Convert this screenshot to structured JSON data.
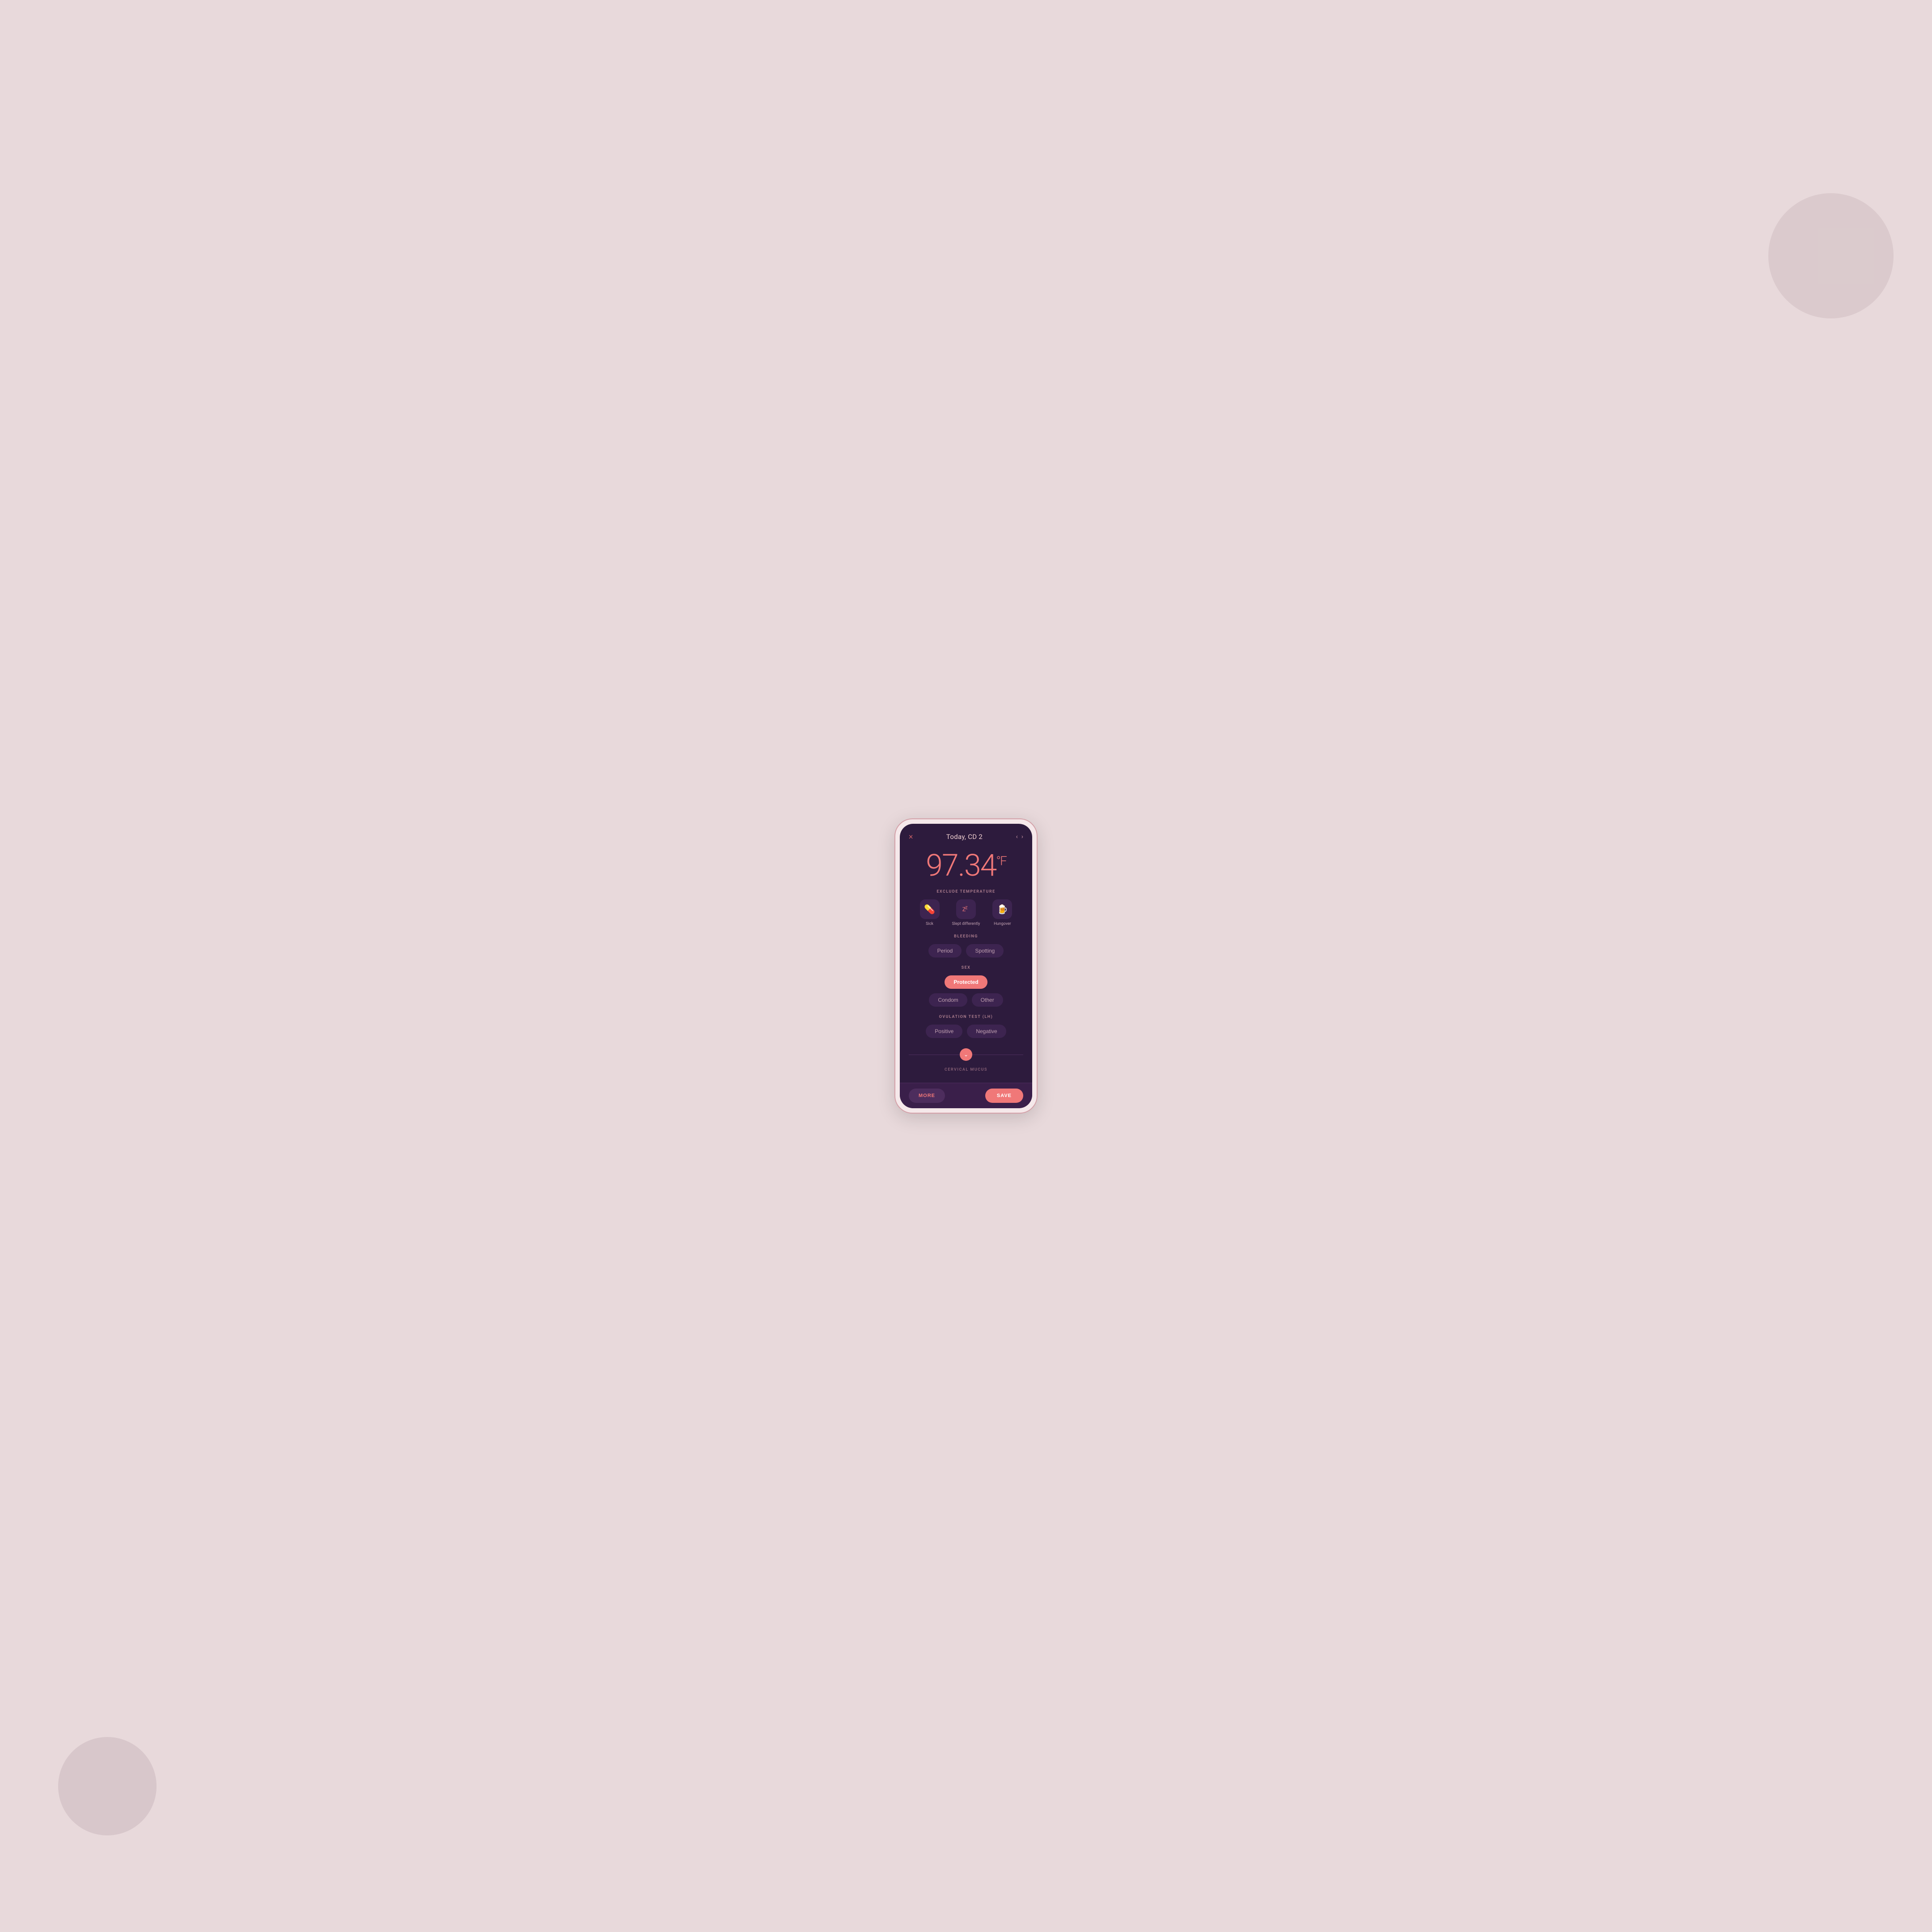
{
  "background": {
    "color": "#e8d9db"
  },
  "header": {
    "close_label": "×",
    "title": "Today, CD 2",
    "arrow_left": "‹",
    "arrow_right": "›"
  },
  "temperature": {
    "value": "97.34",
    "unit": "°F"
  },
  "sections": {
    "exclude_temperature": {
      "label": "EXCLUDE TEMPERATURE",
      "items": [
        {
          "icon": "💊",
          "label": "Sick"
        },
        {
          "icon": "💤",
          "label": "Slept differently"
        },
        {
          "icon": "🍺",
          "label": "Hungover"
        }
      ]
    },
    "bleeding": {
      "label": "BLEEDING",
      "buttons": [
        {
          "label": "Period",
          "active": false
        },
        {
          "label": "Spotting",
          "active": false
        }
      ]
    },
    "sex": {
      "label": "SEX",
      "buttons": [
        {
          "label": "Protected",
          "active": true
        },
        {
          "label": "Condom",
          "active": false
        },
        {
          "label": "Other",
          "active": false
        }
      ]
    },
    "ovulation_test": {
      "label": "OVULATION TEST (LH)",
      "buttons": [
        {
          "label": "Positive",
          "active": false
        },
        {
          "label": "Negative",
          "active": false
        }
      ]
    },
    "cervical_mucus": {
      "label": "CERVICAL MUCUS"
    }
  },
  "footer": {
    "more_label": "MORE",
    "save_label": "SAVE"
  }
}
